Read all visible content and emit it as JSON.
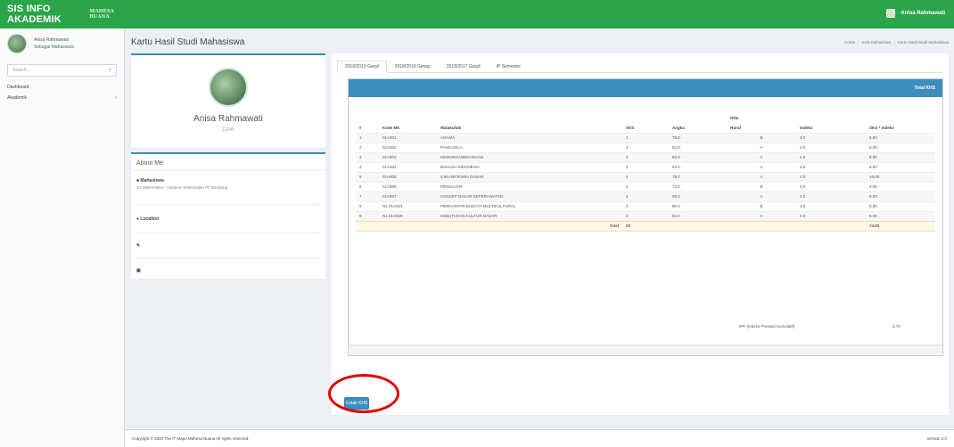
{
  "app": {
    "brand": "SIS INFO AKADEMIK",
    "brand_sub": "MAHESA BUANA",
    "user_name": "Anisa Rahmawati"
  },
  "sidebar": {
    "user_name": "Anisa Rahmawati",
    "user_status": "Sebagai Mahasiswa",
    "search_placeholder": "Search...",
    "items": [
      {
        "label": "Dashboard"
      },
      {
        "label": "Akademik"
      }
    ]
  },
  "header": {
    "title": "Kartu Hasil Studi Mahasiswa",
    "breadcrumb": [
      "Home",
      "KHS Mahasiswa",
      "Kartu Hasil Studi Mahasiswa"
    ]
  },
  "profile": {
    "name": "Anisa Rahmawati",
    "role": "12345"
  },
  "about": {
    "title": "About Me",
    "status_label": "Mahasiswa",
    "status_text": "S1 Matematika - Akademi Matematika PF Bandung",
    "location_label": "Location"
  },
  "tabs": [
    {
      "label": "2018/2019 Ganjil",
      "active": true
    },
    {
      "label": "2018/2019 Genap",
      "active": false
    },
    {
      "label": "2018/2017 Ganjil",
      "active": false
    },
    {
      "label": "IP Semester",
      "active": false
    }
  ],
  "khs": {
    "header_label": "Total KHS",
    "columns": [
      "#",
      "Kode MK",
      "Matakuliah",
      "SKS",
      "Angka",
      "Huruf",
      "Indeks",
      "SKS * Indeks"
    ],
    "group_header": "Nilai",
    "rows": [
      [
        "1",
        "01A001",
        "AGAMA",
        "2",
        "78.0",
        "B",
        "3.0",
        "6.00"
      ],
      [
        "2",
        "01A002",
        "PANCASILA",
        "2",
        "84.0",
        "A",
        "4.0",
        "8.00"
      ],
      [
        "3",
        "01A003",
        "KEWARGANEGARAAN",
        "2",
        "82.0",
        "A",
        "4.0",
        "8.00"
      ],
      [
        "4",
        "01A004",
        "BAHASA INDONESIA",
        "2",
        "84.0",
        "A",
        "4.0",
        "8.00"
      ],
      [
        "5",
        "01A005",
        "ILMU BIOKIMIA DASAR",
        "4",
        "79.0",
        "A",
        "4.0",
        "16.00"
      ],
      [
        "6",
        "01A006",
        "PENGAJAR",
        "2",
        "73.0",
        "B",
        "3.0",
        "6.00"
      ],
      [
        "7",
        "01A007",
        "KONSEP DASAR KEPERAWATAN",
        "2",
        "88.0",
        "A",
        "4.0",
        "8.00"
      ],
      [
        "8",
        "N1.01A024",
        "PENGANTAR BUDAYA MULTIKULTURAL",
        "2",
        "80.0",
        "B",
        "3.0",
        "6.00"
      ],
      [
        "9",
        "N1.01A025",
        "KEBUTUHAN KULTUR DASAR",
        "2",
        "82.0",
        "A",
        "4.0",
        "8.00"
      ]
    ],
    "total_label": "Total",
    "total_sks": "20",
    "total_sks_indeks": "74.00",
    "ipk_label": "IPK (Indeks Prestasi Kumulatif)",
    "ipk_value": "3.70",
    "print_button": "Cetak KHS"
  },
  "footer": {
    "copyright": "Copyright © 2020 The IT Mapu Mahesa Buana All rights reserved.",
    "version": "Version 2.0"
  }
}
